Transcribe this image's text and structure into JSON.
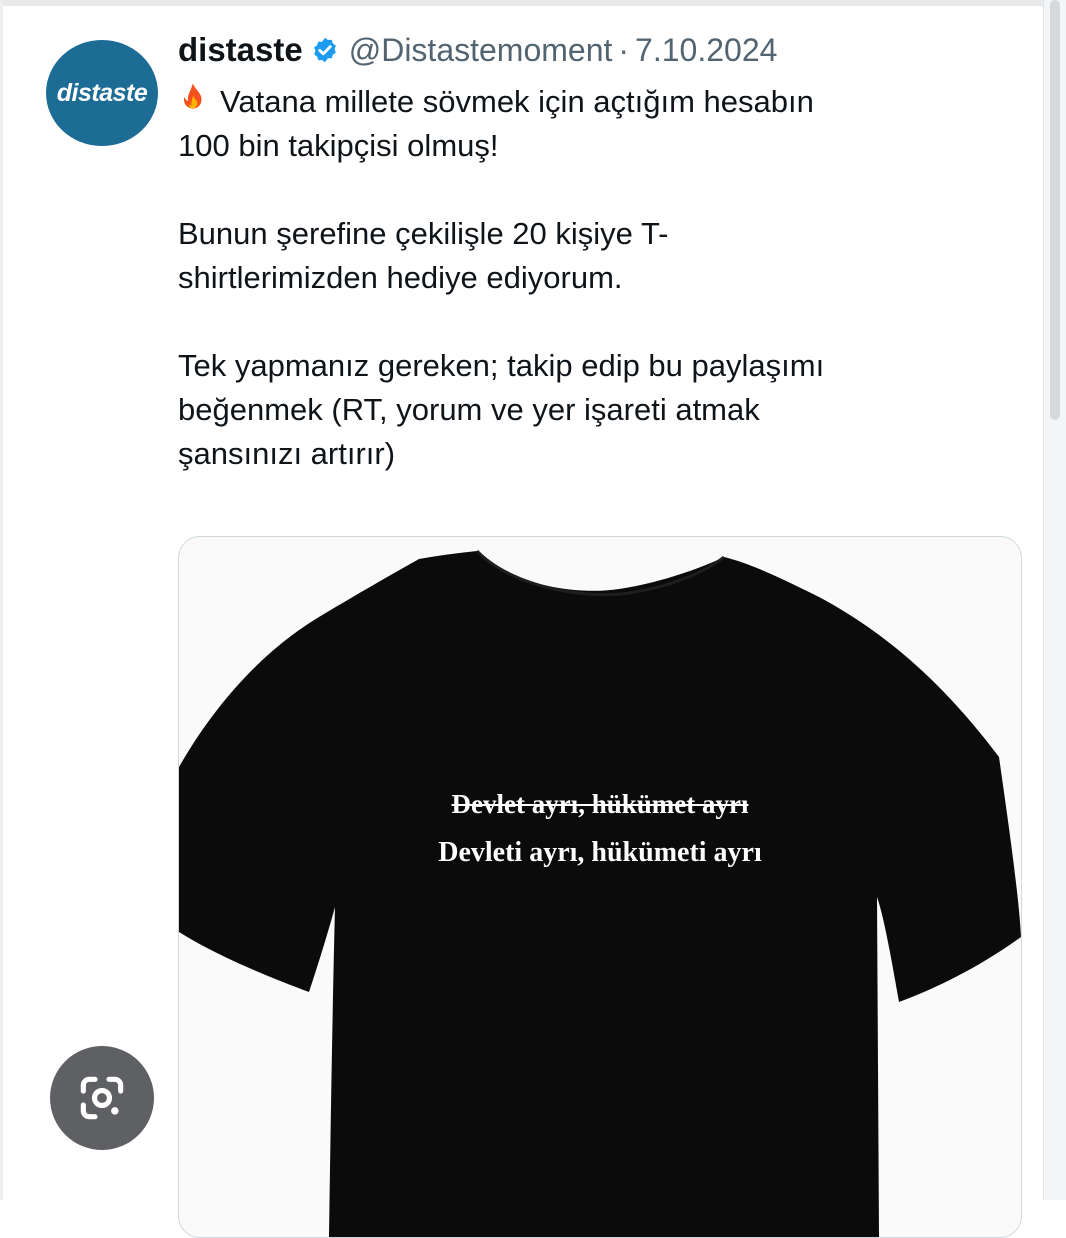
{
  "tweet": {
    "avatar_text": "distaste",
    "display_name": "distaste",
    "verified": "verified-badge-icon",
    "handle": "@Distastemoment",
    "separator": "·",
    "date": "7.10.2024",
    "emoji": "fire-icon",
    "lines": [
      "Vatana millete sövmek için açtığım hesabın",
      "100 bin takipçisi olmuş!",
      "Bunun şerefine çekilişle 20 kişiye T-",
      "shirtlerimizden hediye ediyorum.",
      "Tek yapmanız gereken; takip edip bu paylaşımı",
      "beğenmek (RT, yorum ve yer işareti atmak",
      "şansınızı artırır)"
    ]
  },
  "media": {
    "shirt_text_struck": "Devlet ayrı, hükümet ayrı",
    "shirt_text": "Devleti ayrı, hükümeti ayrı"
  },
  "overlay": {
    "lens_icon": "lens-search-icon"
  },
  "colors": {
    "accent": "#1d9bf0",
    "avatar_bg": "#1d6c96",
    "secondary_text": "#536471"
  }
}
